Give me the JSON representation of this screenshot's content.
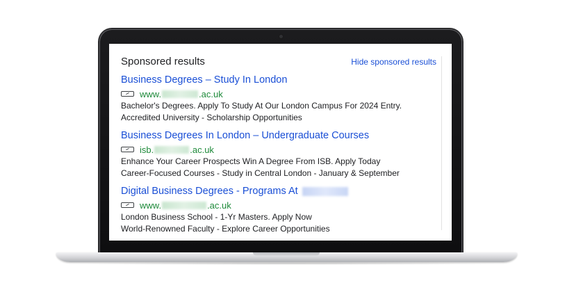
{
  "header": {
    "title": "Sponsored results",
    "hide_link": "Hide sponsored results"
  },
  "ads": [
    {
      "title": "Business Degrees – Study In London",
      "url_prefix": "www.",
      "url_suffix": ".ac.uk",
      "desc_line1": "Bachelor's Degrees. Apply To Study At Our London Campus For 2024 Entry.",
      "desc_line2": "Accredited University - Scholarship Opportunities"
    },
    {
      "title": "Business Degrees In London – Undergraduate Courses",
      "url_prefix": "isb.",
      "url_suffix": ".ac.uk",
      "desc_line1": "Enhance Your Career Prospects Win A Degree From ISB. Apply Today",
      "desc_line2": "Career-Focused Courses - Study in Central London - January & September"
    },
    {
      "title": "Digital Business Degrees - Programs At",
      "url_prefix": "www.",
      "url_suffix": ".ac.uk",
      "desc_line1": "London Business School - 1-Yr Masters. Apply Now",
      "desc_line2": "World-Renowned Faculty - Explore Career Opportunities"
    }
  ],
  "colors": {
    "link_blue": "#1a4fd6",
    "url_green": "#1e8a3a",
    "text_dark": "#202124"
  },
  "icons": {
    "ad_badge": "external-ad-badge-icon"
  }
}
